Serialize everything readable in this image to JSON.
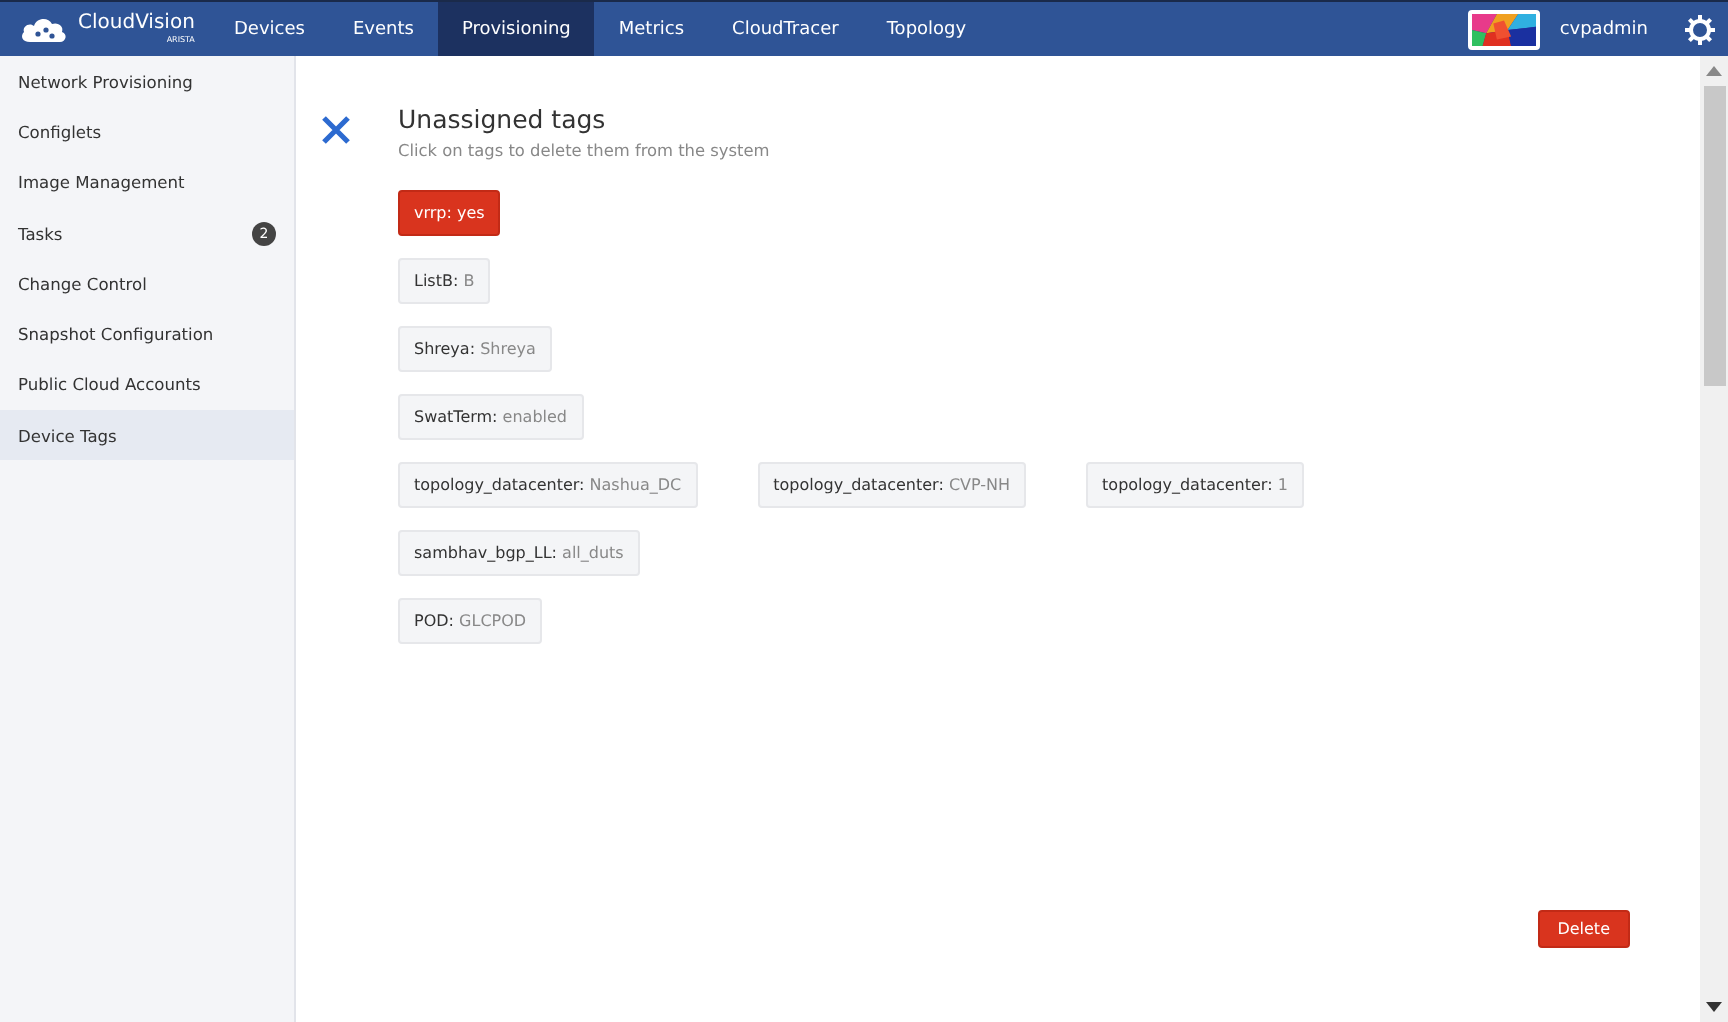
{
  "brand": {
    "name": "CloudVision",
    "sub": "ARISTA"
  },
  "nav": [
    {
      "label": "Devices",
      "selected": false
    },
    {
      "label": "Events",
      "selected": false
    },
    {
      "label": "Provisioning",
      "selected": true
    },
    {
      "label": "Metrics",
      "selected": false
    },
    {
      "label": "CloudTracer",
      "selected": false
    },
    {
      "label": "Topology",
      "selected": false
    }
  ],
  "user": {
    "name": "cvpadmin"
  },
  "sidebar": {
    "items": [
      {
        "label": "Network Provisioning",
        "selected": false
      },
      {
        "label": "Configlets",
        "selected": false
      },
      {
        "label": "Image Management",
        "selected": false
      },
      {
        "label": "Tasks",
        "selected": false,
        "badge": "2"
      },
      {
        "label": "Change Control",
        "selected": false
      },
      {
        "label": "Snapshot Configuration",
        "selected": false
      },
      {
        "label": "Public Cloud Accounts",
        "selected": false
      },
      {
        "label": "Device Tags",
        "selected": true
      }
    ]
  },
  "panel": {
    "title": "Unassigned tags",
    "subtitle": "Click on tags to delete them from the system",
    "tag_rows": [
      [
        {
          "name": "vrrp:",
          "value": "yes",
          "selected": true
        }
      ],
      [
        {
          "name": "ListB:",
          "value": "B",
          "selected": false
        }
      ],
      [
        {
          "name": "Shreya:",
          "value": "Shreya",
          "selected": false
        }
      ],
      [
        {
          "name": "SwatTerm:",
          "value": "enabled",
          "selected": false
        }
      ],
      [
        {
          "name": "topology_datacenter:",
          "value": "Nashua_DC",
          "selected": false
        },
        {
          "name": "topology_datacenter:",
          "value": "CVP-NH",
          "selected": false
        },
        {
          "name": "topology_datacenter:",
          "value": "1",
          "selected": false
        }
      ],
      [
        {
          "name": "sambhav_bgp_LL:",
          "value": "all_duts",
          "selected": false
        }
      ],
      [
        {
          "name": "POD:",
          "value": "GLCPOD",
          "selected": false
        }
      ]
    ],
    "delete_button": "Delete"
  }
}
